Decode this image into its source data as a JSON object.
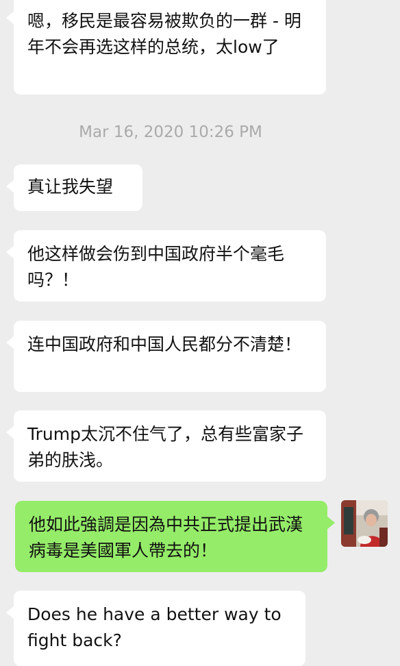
{
  "messages": [
    {
      "direction": "in",
      "text": "嗯，移民是最容易被欺负的一群 - 明年不会再选这样的总统，太low了"
    },
    {
      "direction": "in",
      "text": "真让我失望"
    },
    {
      "direction": "in",
      "text": "他这样做会伤到中国政府半个毫毛吗？！"
    },
    {
      "direction": "in",
      "text": "连中国政府和中国人民都分不清楚！"
    },
    {
      "direction": "in",
      "text": "Trump太沉不住气了，总有些富家子弟的肤浅。"
    },
    {
      "direction": "out",
      "text": "他如此強調是因為中共正式提出武漢病毒是美國軍人帶去的！"
    },
    {
      "direction": "in",
      "text": "Does he have a better way to fight back?"
    }
  ],
  "timestamp": "Mar 16, 2020 10:26 PM",
  "colors": {
    "background": "#ededed",
    "incoming_bubble": "#ffffff",
    "outgoing_bubble": "#95ec69",
    "timestamp_text": "#aaaaaa"
  },
  "avatar": {
    "description": "user-avatar-photo"
  }
}
